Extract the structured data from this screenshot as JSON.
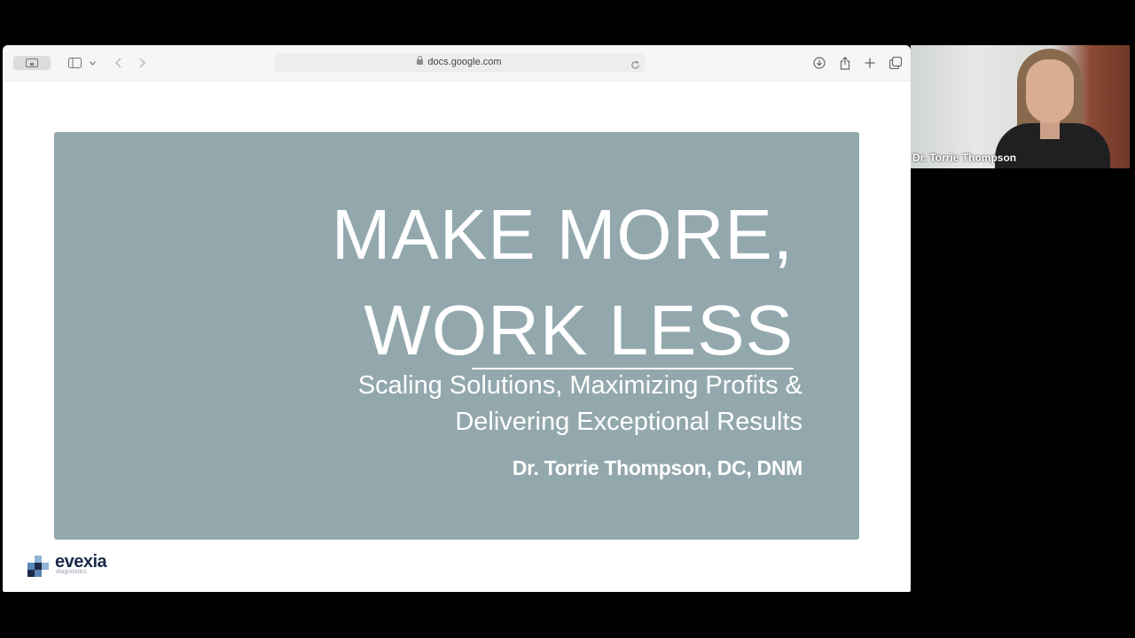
{
  "browser": {
    "address": "docs.google.com",
    "toolbar_icons": [
      "sidebar-pill-icon",
      "sidebar-icon",
      "chevron-down-icon",
      "back-icon",
      "forward-icon",
      "lock-icon",
      "reload-icon",
      "download-icon",
      "share-icon",
      "new-tab-icon",
      "tabs-overview-icon"
    ]
  },
  "slide": {
    "title_line_1": "MAKE MORE,",
    "title_line_2": "WORK LESS",
    "subtitle_line_1": "Scaling Solutions, Maximizing Profits &",
    "subtitle_line_2": "Delivering Exceptional Results",
    "author": "Dr. Torrie Thompson, DC, DNM",
    "background_color": "#93a8ad"
  },
  "logo": {
    "name": "evexia",
    "tagline": "diagnostics"
  },
  "video": {
    "participant_name": "Dr. Torrie Thompson"
  }
}
